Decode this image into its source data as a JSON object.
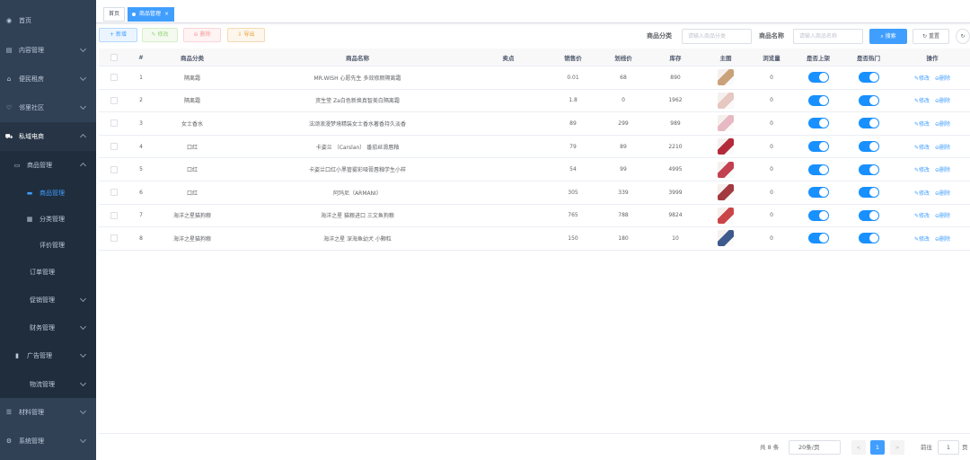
{
  "sidebar": {
    "items": [
      {
        "label": "首页",
        "icon": "dashboard-icon"
      },
      {
        "label": "内容管理",
        "icon": "content-icon"
      },
      {
        "label": "便民租房",
        "icon": "home-icon"
      },
      {
        "label": "邻里社区",
        "icon": "community-icon"
      },
      {
        "label": "私域电商",
        "icon": "cart-icon"
      },
      {
        "label": "商品管理",
        "icon": "monitor-icon"
      },
      {
        "label": "商品管理",
        "icon": "list-icon"
      },
      {
        "label": "分类管理",
        "icon": "grid-icon"
      },
      {
        "label": "评价管理"
      },
      {
        "label": "订单管理"
      },
      {
        "label": "促销管理"
      },
      {
        "label": "财务管理"
      },
      {
        "label": "广告管理",
        "icon": "bar-chart-icon"
      },
      {
        "label": "物流管理"
      },
      {
        "label": "材料管理",
        "icon": "material-icon"
      },
      {
        "label": "系统管理",
        "icon": "gear-icon"
      }
    ]
  },
  "tabs": {
    "home": "首页",
    "active": "商品管理",
    "close": "×"
  },
  "toolbar": {
    "add": "+ 新增",
    "edit": "✎ 修改",
    "delete": "⊖ 删除",
    "export": "⇩ 导出",
    "category_label": "商品分类",
    "category_placeholder": "请输入商品分类",
    "name_label": "商品名称",
    "name_placeholder": "请输入商品名称",
    "search": "⌕ 搜索",
    "reset": "↻ 重置",
    "refresh": "↻"
  },
  "table": {
    "headers": [
      "#",
      "商品分类",
      "商品名称",
      "卖点",
      "销售价",
      "划线价",
      "库存",
      "主图",
      "浏览量",
      "是否上架",
      "是否热门",
      "操作"
    ],
    "rows": [
      {
        "idx": "1",
        "category": "隔离霜",
        "name": "MR.WISH 心愿先生 多效修颜隔离霜",
        "point": "",
        "price": "0.01",
        "origin": "68",
        "stock": "890",
        "views": "0",
        "thumb": "#c9a27a"
      },
      {
        "idx": "2",
        "category": "隔离霜",
        "name": "资生堂 Za白色新焕真智美白隔离霜",
        "point": "",
        "price": "1.8",
        "origin": "0",
        "stock": "1962",
        "views": "0",
        "thumb": "#e6c7c2"
      },
      {
        "idx": "3",
        "category": "女士香水",
        "name": "法颂浪漫梦境精装女士香水著香持久淡香",
        "point": "",
        "price": "89",
        "origin": "299",
        "stock": "989",
        "views": "0",
        "thumb": "#e7b9c2"
      },
      {
        "idx": "4",
        "category": "口红",
        "name": "卡姿兰 （Carslan） 番茄丝滑唇釉",
        "point": "",
        "price": "79",
        "origin": "89",
        "stock": "2210",
        "views": "0",
        "thumb": "#b32b3a"
      },
      {
        "idx": "5",
        "category": "口红",
        "name": "卡姿兰口红小黑管雾彩哑膏唇釉学生小样",
        "point": "",
        "price": "54",
        "origin": "99",
        "stock": "4995",
        "views": "0",
        "thumb": "#c2404f"
      },
      {
        "idx": "6",
        "category": "口红",
        "name": "阿玛尼（ARMANI）",
        "point": "",
        "price": "305",
        "origin": "339",
        "stock": "3999",
        "views": "0",
        "thumb": "#a23a3f"
      },
      {
        "idx": "7",
        "category": "海洋之星猫狗粮",
        "name": "海洋之星 猫粮进口 三文鱼狗粮",
        "point": "",
        "price": "765",
        "origin": "788",
        "stock": "9824",
        "views": "0",
        "thumb": "#c94548"
      },
      {
        "idx": "8",
        "category": "海洋之星猫狗粮",
        "name": "海洋之星 深海鱼幼犬 小颗粒",
        "point": "",
        "price": "150",
        "origin": "180",
        "stock": "10",
        "views": "0",
        "thumb": "#3e5a8c"
      }
    ],
    "edit_action": "✎修改",
    "delete_action": "⊖删除"
  },
  "pagination": {
    "total": "共 8 条",
    "page_size": "20条/页",
    "current": "1",
    "prev": "<",
    "next": ">",
    "goto": "前往",
    "goto_value": "1",
    "page_suffix": "页"
  }
}
